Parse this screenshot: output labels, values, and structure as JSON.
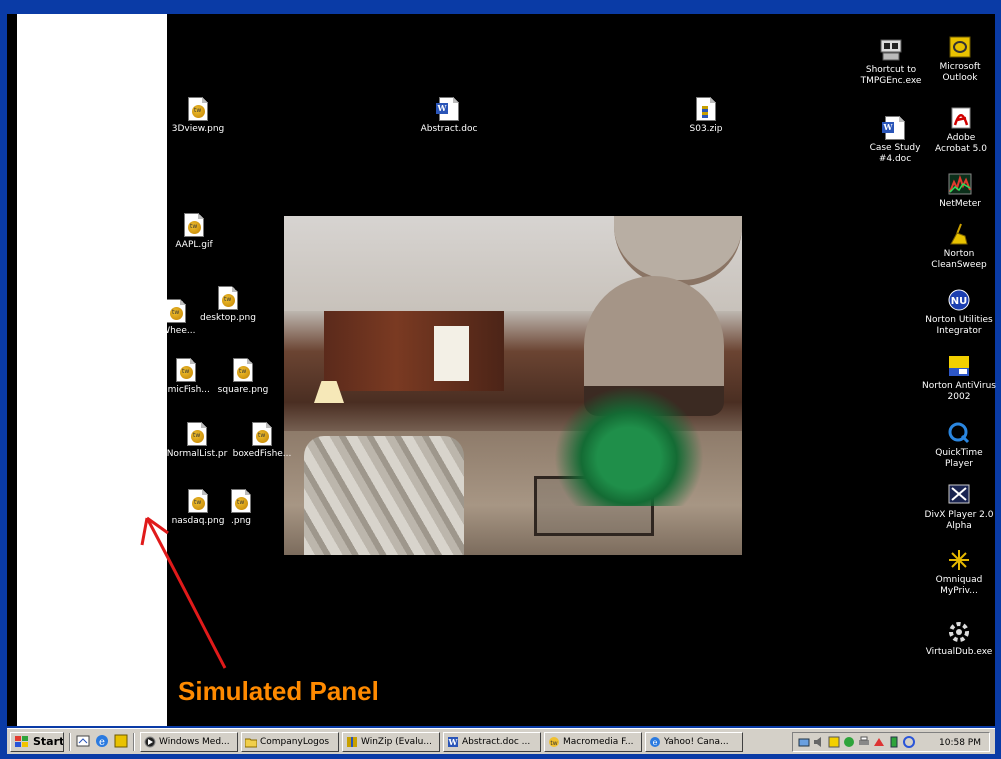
{
  "desktop_icons": [
    {
      "label": "3Dview.png",
      "kind": "png"
    },
    {
      "label": "Abstract.doc",
      "kind": "doc"
    },
    {
      "label": "S03.zip",
      "kind": "zip"
    },
    {
      "label": "AAPL.gif",
      "kind": "png"
    },
    {
      "label": "desktop.png",
      "kind": "png"
    },
    {
      "label": "sWhee...",
      "kind": "png"
    },
    {
      "label": "amicFish...",
      "kind": "png"
    },
    {
      "label": "square.png",
      "kind": "png"
    },
    {
      "label": "NormalList.pr",
      "kind": "png"
    },
    {
      "label": "boxedFishe...",
      "kind": "png"
    },
    {
      "label": "nasdaq.png",
      "kind": "png"
    },
    {
      "label": ".png",
      "kind": "png"
    }
  ],
  "right_icons": [
    {
      "label": "Shortcut to TMPGEnc.exe",
      "icon": "tmpgenc-icon"
    },
    {
      "label": "Microsoft Outlook",
      "icon": "outlook-icon"
    },
    {
      "label": "Case Study #4.doc",
      "icon": "word-doc-icon"
    },
    {
      "label": "Adobe Acrobat 5.0",
      "icon": "acrobat-icon"
    },
    {
      "label": "NetMeter",
      "icon": "netmeter-icon"
    },
    {
      "label": "Norton CleanSweep",
      "icon": "cleansweep-icon"
    },
    {
      "label": "Norton Utilities Integrator",
      "icon": "norton-utilities-icon"
    },
    {
      "label": "Norton AntiVirus 2002",
      "icon": "norton-antivirus-icon"
    },
    {
      "label": "QuickTime Player",
      "icon": "quicktime-icon"
    },
    {
      "label": "DivX Player 2.0 Alpha",
      "icon": "divx-icon"
    },
    {
      "label": "Omniquad MyPriv...",
      "icon": "omniquad-icon"
    },
    {
      "label": "VirtualDub.exe",
      "icon": "virtualdub-icon"
    }
  ],
  "annotation": {
    "text": "Simulated Panel",
    "color": "#ff8a00"
  },
  "taskbar": {
    "start_label": "Start",
    "tasks": [
      {
        "label": "Windows Med...",
        "icon": "media-player-icon"
      },
      {
        "label": "CompanyLogos",
        "icon": "folder-icon"
      },
      {
        "label": "WinZip (Evalu...",
        "icon": "winzip-icon"
      },
      {
        "label": "Abstract.doc ...",
        "icon": "word-icon"
      },
      {
        "label": "Macromedia F...",
        "icon": "macromedia-icon"
      },
      {
        "label": "Yahoo! Cana...",
        "icon": "ie-icon"
      }
    ],
    "clock": "10:58 PM"
  },
  "colors": {
    "desktop": "#000000",
    "panel": "#ffffff",
    "frame": "#0a3ba6",
    "taskbar": "#d4d0c8"
  }
}
